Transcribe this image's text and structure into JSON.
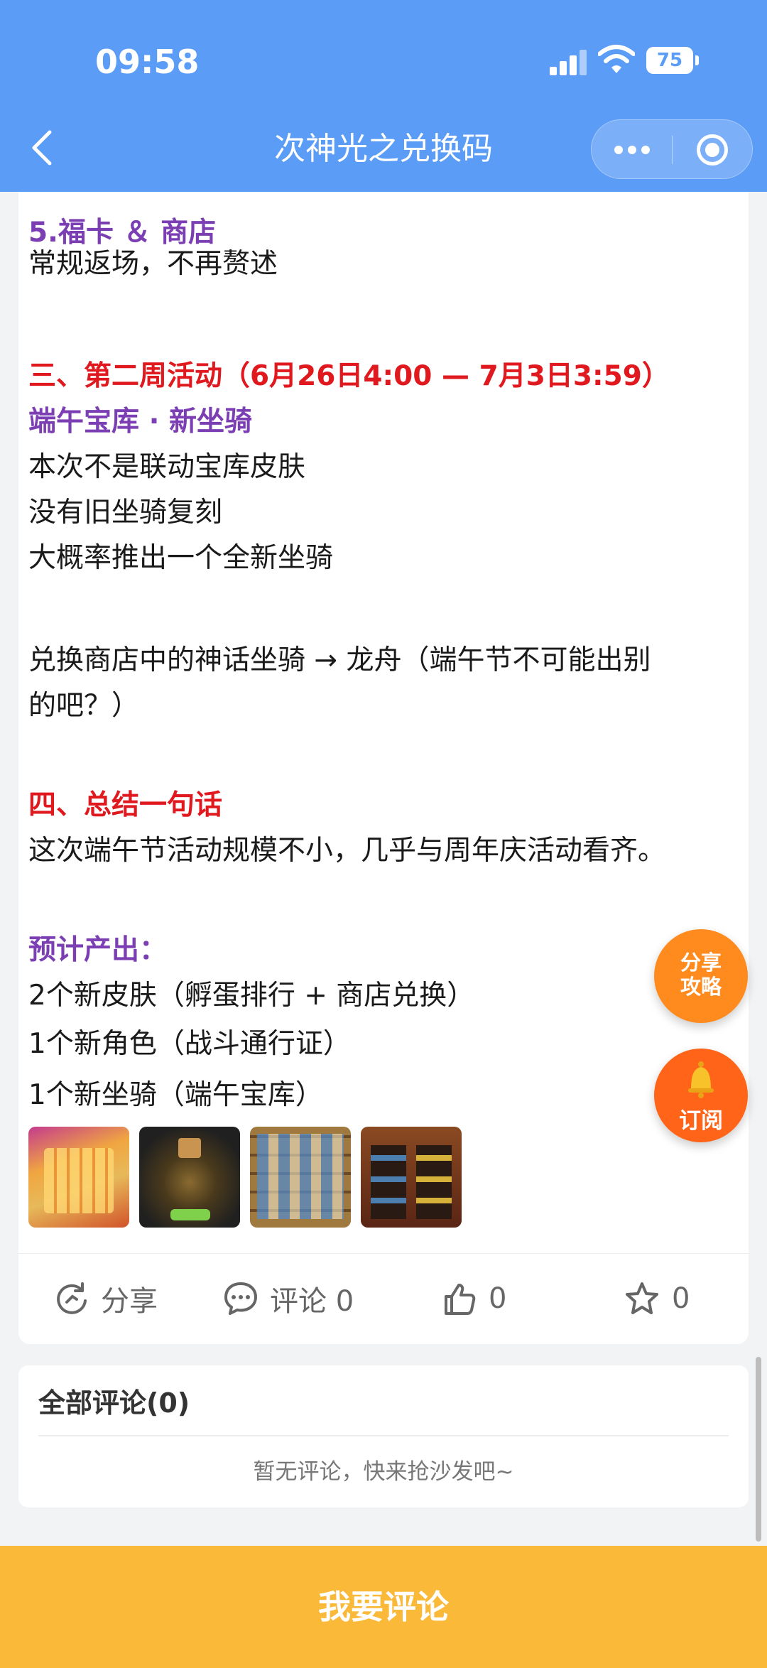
{
  "status_bar": {
    "time": "09:58",
    "battery": "75"
  },
  "nav": {
    "title": "次神光之兑换码"
  },
  "article": {
    "lines": [
      "5.福卡 ＆ 商店",
      "常规返场，不再赘述",
      "三、第二周活动（6月26日4:00 — 7月3日3:59）",
      "端午宝库 · 新坐骑",
      "本次不是联动宝库皮肤",
      "没有旧坐骑复刻",
      "大概率推出一个全新坐骑",
      "兑换商店中的神话坐骑 → 龙舟（端午节不可能出别",
      "的吧？）",
      "四、总结一句话",
      "这次端午节活动规模不小，几乎与周年庆活动看齐。",
      "预计产出：",
      "2个新皮肤（孵蛋排行 + 商店兑换）",
      "1个新角色（战斗通行证）",
      "1个新坐骑（端午宝库）"
    ]
  },
  "actions": {
    "share": "分享",
    "comment": "评论 0",
    "like": "0",
    "favorite": "0"
  },
  "comments": {
    "title": "全部评论(0)",
    "empty": "暂无评论，快来抢沙发吧~"
  },
  "floating": {
    "share_guide_line1": "分享",
    "share_guide_line2": "攻略",
    "subscribe": "订阅"
  },
  "bottom": {
    "comment_button": "我要评论"
  },
  "colors": {
    "header": "#5b9cf7",
    "purple": "#7b3fb3",
    "red": "#e0191f",
    "bottom": "#fbb93a"
  }
}
